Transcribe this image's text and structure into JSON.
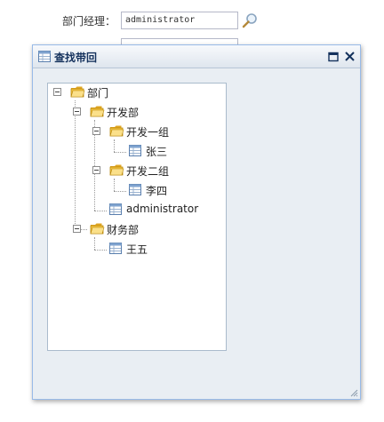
{
  "form": {
    "manager_label": "部门经理：",
    "manager_value": "administrator"
  },
  "dialog": {
    "title": "查找带回"
  },
  "tree": {
    "root": "部门",
    "dept_dev": "开发部",
    "group1": "开发一组",
    "user_zhangsan": "张三",
    "group2": "开发二组",
    "user_lisi": "李四",
    "user_admin": "administrator",
    "dept_finance": "财务部",
    "user_wangwu": "王五"
  },
  "colors": {
    "accent": "#15325d",
    "folder": "#f5c542",
    "dialog_bg": "#e9eef3"
  }
}
